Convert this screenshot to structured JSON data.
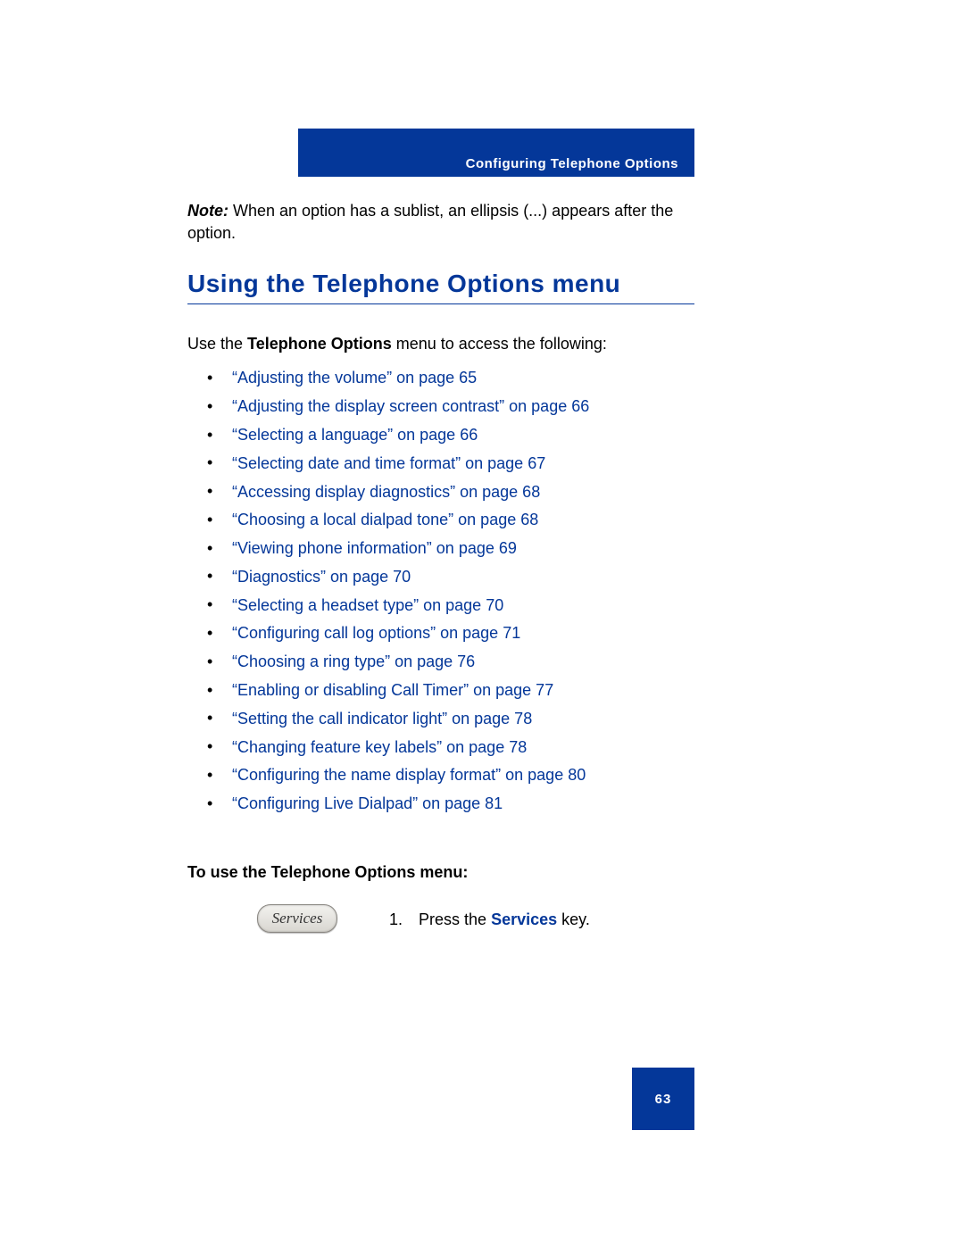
{
  "header": {
    "title": "Configuring Telephone Options"
  },
  "note": {
    "label": "Note:",
    "text": " When an option has a sublist, an ellipsis (...) appears after the option."
  },
  "section_heading": "Using the Telephone Options menu",
  "intro": {
    "prefix": "Use the ",
    "bold": "Telephone Options",
    "suffix": " menu to access the following:"
  },
  "toc": [
    "“Adjusting the volume” on page 65",
    "“Adjusting the display screen contrast” on page 66",
    "“Selecting a language” on page 66",
    "“Selecting date and time format” on page 67",
    "“Accessing display diagnostics” on page 68",
    "“Choosing a local dialpad tone” on page 68",
    "“Viewing phone information” on page 69",
    "“Diagnostics” on page 70",
    "“Selecting a headset type” on page 70",
    "“Configuring call log options” on page 71",
    "“Choosing a ring type” on page 76",
    "“Enabling or disabling Call Timer” on page 77",
    "“Setting the call indicator light” on page 78",
    "“Changing feature key labels” on page 78",
    "“Configuring the name display format” on page 80",
    "“Configuring Live Dialpad” on page 81"
  ],
  "subhead": "To use the Telephone Options menu:",
  "services_key_label": "Services",
  "step": {
    "number": "1.",
    "prefix": "Press the ",
    "keyword": "Services",
    "suffix": " key."
  },
  "page_number": "63"
}
